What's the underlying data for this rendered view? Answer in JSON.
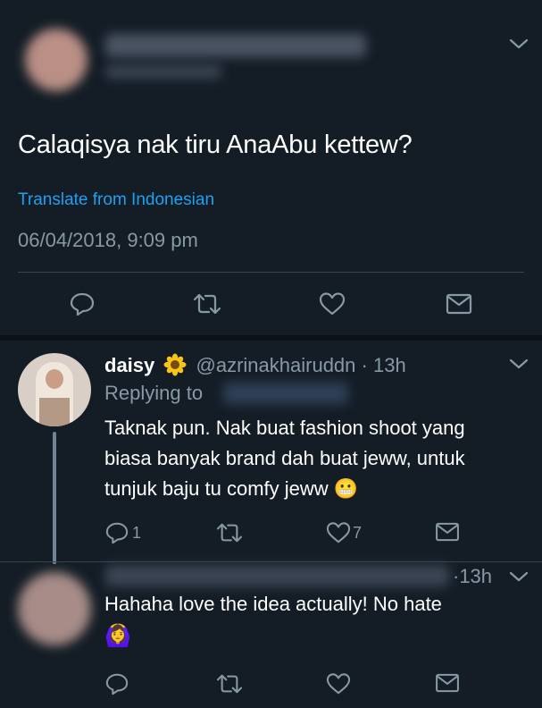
{
  "main_tweet": {
    "text": "Calaqisya nak tiru AnaAbu kettew?",
    "translate": "Translate from Indonesian",
    "timestamp": "06/04/2018, 9:09 pm"
  },
  "replies": [
    {
      "display_name": "daisy",
      "emoji": "🌼",
      "handle": "@azrinakhairuddn",
      "dot": "·",
      "time": "13h",
      "replying_to": "Replying to",
      "text_lines": [
        "Taknak pun. Nak buat fashion shoot yang",
        "biasa banyak brand dah buat jeww, untuk",
        "tunjuk baju tu comfy jeww 😬"
      ],
      "reply_count": "1",
      "like_count": "7"
    },
    {
      "time": "·13h",
      "text": "Hahaha love the idea actually! No hate",
      "emoji": "🙆‍♀️"
    }
  ],
  "colors": {
    "background": "#141d26",
    "link": "#1da1f2",
    "secondary": "#8899a6",
    "divider": "#38444d"
  },
  "icons": [
    "chevron-down-icon",
    "reply-icon",
    "retweet-icon",
    "like-icon",
    "share-icon",
    "sunflower-icon"
  ]
}
